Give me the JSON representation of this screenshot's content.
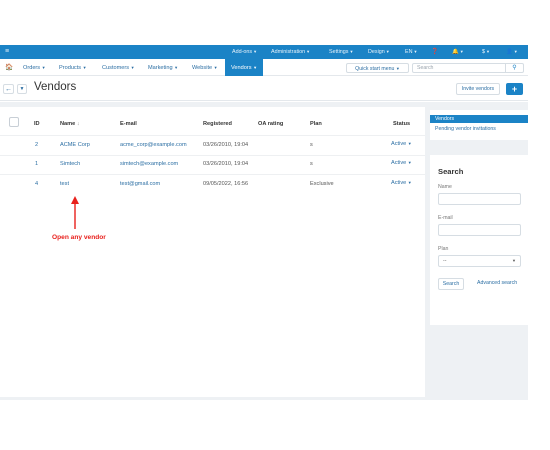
{
  "topbar": {
    "menu_icon": "hamburger-icon",
    "addons": "Add-ons",
    "administration": "Administration",
    "settings": "Settings",
    "design": "Design",
    "language": "EN",
    "currency": "$"
  },
  "navbar": {
    "home_icon": "home-icon",
    "orders": "Orders",
    "products": "Products",
    "customers": "Customers",
    "marketing": "Marketing",
    "website": "Website",
    "vendors": "Vendors",
    "quick_start": "Quick start menu",
    "search_placeholder": "Search"
  },
  "titlebar": {
    "title": "Vendors",
    "invite_label": "Invite vendors",
    "add_label": "+"
  },
  "table": {
    "headers": {
      "id": "ID",
      "name": "Name",
      "name_sort": "↓",
      "email": "E-mail",
      "registered": "Registered",
      "oa_rating": "OA rating",
      "plan": "Plan",
      "status": "Status"
    },
    "rows": [
      {
        "id": "2",
        "name": "ACME Corp",
        "email": "acme_corp@example.com",
        "registered": "03/26/2010, 19:04",
        "plan": "s",
        "status": "Active"
      },
      {
        "id": "1",
        "name": "Simtech",
        "email": "simtech@example.com",
        "registered": "03/26/2010, 19:04",
        "plan": "s",
        "status": "Active"
      },
      {
        "id": "4",
        "name": "test",
        "email": "test@gmail.com",
        "registered": "09/05/2022, 16:56",
        "plan": "Exclusive",
        "status": "Active"
      }
    ]
  },
  "annotation": {
    "label": "Open any vendor",
    "color": "#e8201c"
  },
  "sidebar": {
    "active_item": "Vendors",
    "pending_link": "Pending vendor invitations",
    "search_title": "Search",
    "name_label": "Name",
    "email_label": "E-mail",
    "plan_label": "Plan",
    "plan_value": "--",
    "search_button": "Search",
    "advanced_search": "Advanced search"
  },
  "colors": {
    "accent": "#1b83c6",
    "link": "#2b6ea3",
    "background": "#eef1f4"
  }
}
